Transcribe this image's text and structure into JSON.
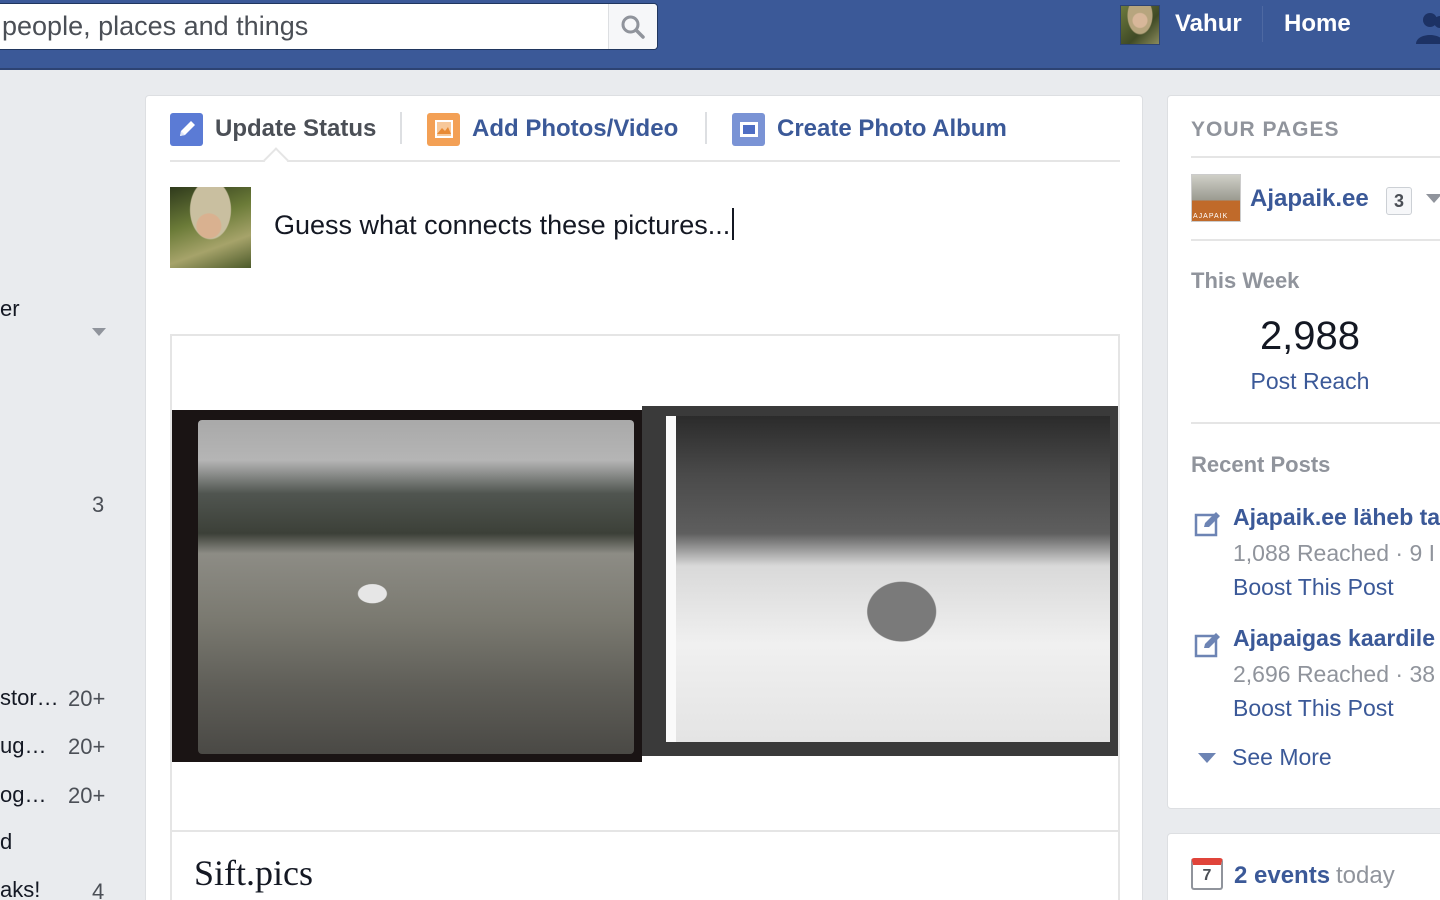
{
  "search": {
    "placeholder": "people, places and things",
    "icon": "search-icon"
  },
  "topnav": {
    "user_name": "Vahur",
    "home_label": "Home",
    "friends_icon": "friend-requests-icon",
    "brand_color": "#3b5998"
  },
  "left_nav": {
    "items": [
      {
        "text": "er",
        "count": ""
      },
      {
        "text": "",
        "count": "3"
      },
      {
        "text": "stor…",
        "count": "20+"
      },
      {
        "text": "ug…",
        "count": "20+"
      },
      {
        "text": "og…",
        "count": "20+"
      },
      {
        "text": "d",
        "count": ""
      },
      {
        "text": "aks!",
        "count": "4"
      }
    ]
  },
  "composer": {
    "tabs": [
      {
        "label": "Update Status",
        "icon": "pencil-icon",
        "active": true
      },
      {
        "label": "Add Photos/Video",
        "icon": "photo-icon",
        "active": false
      },
      {
        "label": "Create Photo Album",
        "icon": "album-icon",
        "active": false
      }
    ],
    "text": "Guess what connects these pictures...",
    "link_preview": {
      "title": "Sift.pics"
    }
  },
  "right": {
    "your_pages_heading": "YOUR PAGES",
    "page_name": "Ajapaik.ee",
    "page_thumb_text": "AJAPAIK",
    "page_badge": "3",
    "this_week_label": "This Week",
    "post_reach_value": "2,988",
    "post_reach_label": "Post Reach",
    "recent_posts_label": "Recent Posts",
    "recent_posts": [
      {
        "title": "Ajapaik.ee läheb ta",
        "stats": "1,088 Reached · 9 I",
        "boost": "Boost This Post"
      },
      {
        "title": "Ajapaigas kaardile",
        "stats": "2,696 Reached · 38",
        "boost": "Boost This Post"
      }
    ],
    "see_more": "See More",
    "events": {
      "calendar_day": "7",
      "count_label": "2 events",
      "when": "today"
    }
  }
}
